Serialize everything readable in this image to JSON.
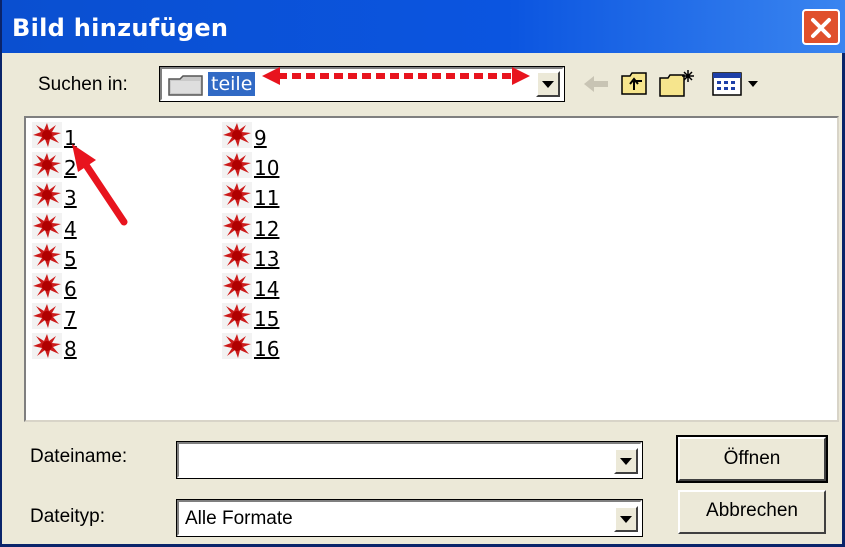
{
  "window": {
    "title": "Bild hinzufügen"
  },
  "toolbar": {
    "look_in_label": "Suchen in:",
    "look_in_value": "teile"
  },
  "files": [
    "1",
    "2",
    "3",
    "4",
    "5",
    "6",
    "7",
    "8",
    "9",
    "10",
    "11",
    "12",
    "13",
    "14",
    "15",
    "16"
  ],
  "filename": {
    "label": "Dateiname:",
    "value": ""
  },
  "filetype": {
    "label": "Dateityp:",
    "value": "Alle Formate"
  },
  "buttons": {
    "open": "Öffnen",
    "cancel": "Abbrechen"
  },
  "colors": {
    "annotation": "#e8141e",
    "title_bar": "#0b55e0",
    "selection": "#316ac5"
  },
  "icons": [
    "folder-icon",
    "back-icon",
    "up-folder-icon",
    "new-folder-icon",
    "view-menu-icon",
    "close-icon",
    "file-icon"
  ]
}
